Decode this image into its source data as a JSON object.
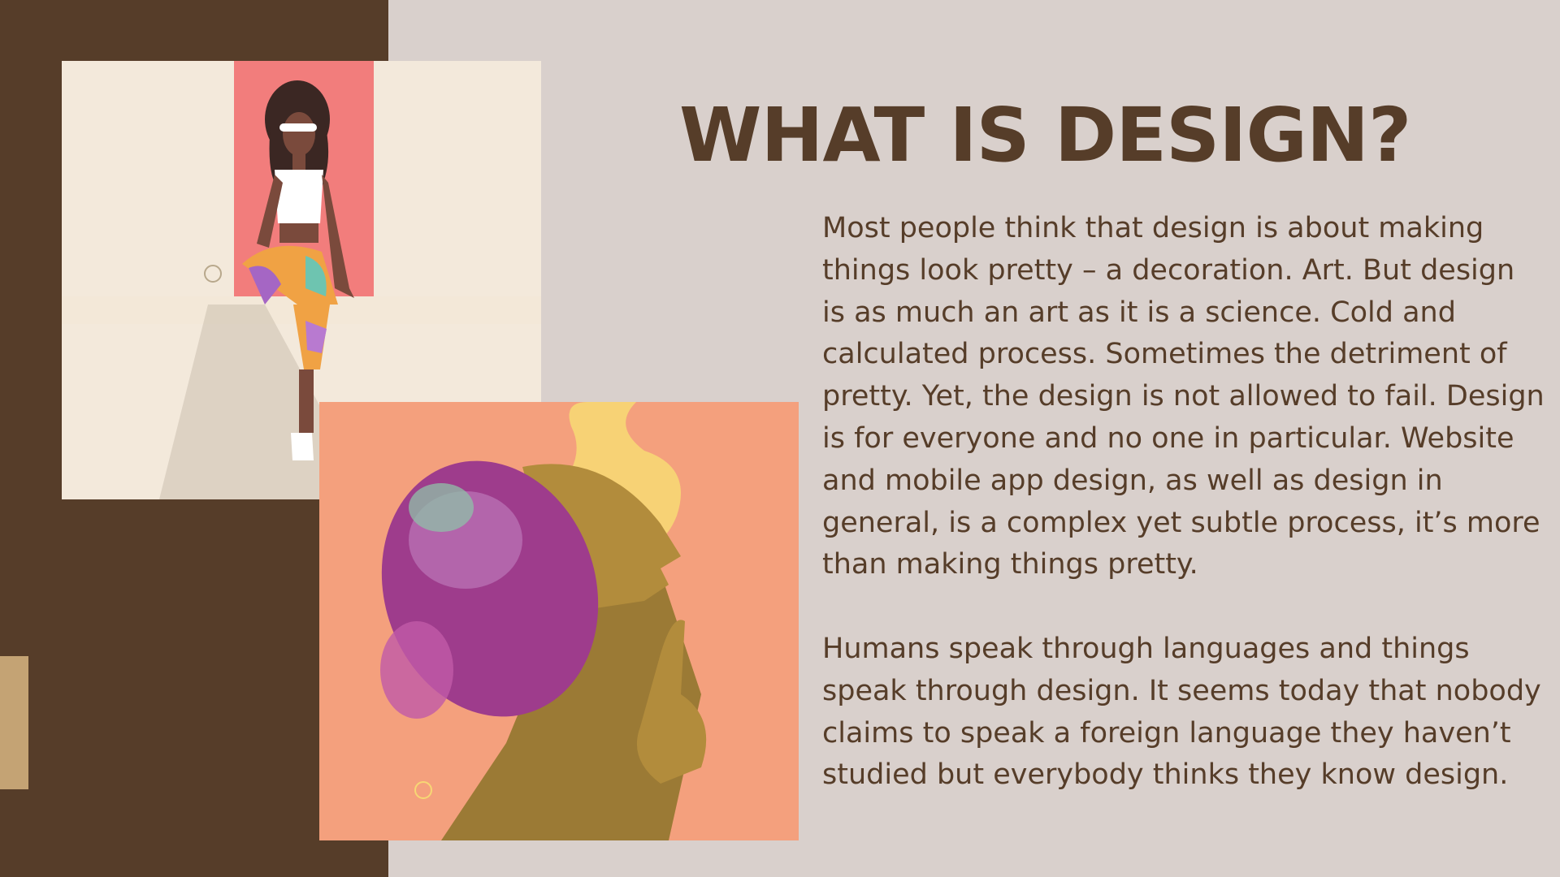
{
  "slide": {
    "title": "WHAT IS DESIGN?",
    "paragraphs": [
      "Most people think that design is about making things look pretty – a decoration. Art. But design is as much an art as it is a science. Cold and calculated process. Sometimes the detriment of pretty. Yet, the design is not allowed to fail. Design is for everyone and no one in particular. Website and mobile app design, as well as design in general, is a complex yet subtle process, it’s more than making things pretty.",
      "Humans speak through languages and things speak through design. It seems today that nobody claims to speak a foreign language they haven’t studied but everybody thinks they know design."
    ]
  },
  "colors": {
    "brown": "#563d29",
    "background": "#d9d0cc",
    "accent": "#c4a374",
    "peach": "#f4a07d",
    "cream": "#f9efe0",
    "coral": "#f27d7c"
  },
  "illustrations": [
    "woman-sitting-illustration",
    "woman-profile-illustration"
  ]
}
